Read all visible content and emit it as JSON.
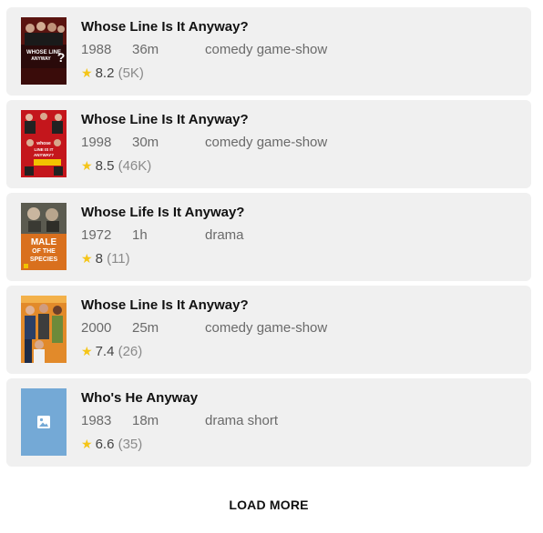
{
  "results": [
    {
      "title": "Whose Line Is It Anyway?",
      "year": "1988",
      "runtime": "36m",
      "genre": "comedy game-show",
      "rating": "8.2",
      "votes": "(5K)",
      "poster_text": [
        "WHOSE LINE",
        "ANYWAY"
      ]
    },
    {
      "title": "Whose Line Is It Anyway?",
      "year": "1998",
      "runtime": "30m",
      "genre": "comedy game-show",
      "rating": "8.5",
      "votes": "(46K)",
      "poster_text": [
        "whose",
        "LINE IS IT",
        "ANYWAY?"
      ]
    },
    {
      "title": "Whose Life Is It Anyway?",
      "year": "1972",
      "runtime": "1h",
      "genre": "drama",
      "rating": "8",
      "votes": "(11)",
      "poster_text": [
        "MALE",
        "OF THE",
        "SPECIES"
      ]
    },
    {
      "title": "Whose Line Is It Anyway?",
      "year": "2000",
      "runtime": "25m",
      "genre": "comedy game-show",
      "rating": "7.4",
      "votes": "(26)"
    },
    {
      "title": "Who's He Anyway",
      "year": "1983",
      "runtime": "18m",
      "genre": "drama short",
      "rating": "6.6",
      "votes": "(35)"
    }
  ],
  "load_more_label": "LOAD MORE",
  "colors": {
    "card_bg": "#f0f0f0",
    "star": "#f5c518",
    "placeholder": "#74a9d6"
  },
  "icons": {
    "rating": "star-icon",
    "missing_poster": "image-placeholder-icon"
  }
}
